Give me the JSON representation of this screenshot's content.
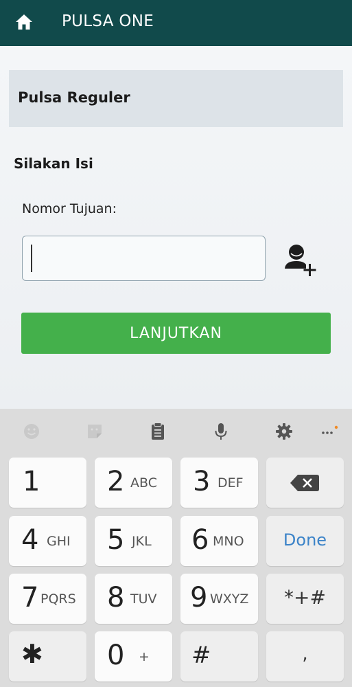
{
  "header": {
    "title": "PULSA ONE",
    "home_icon": "home-icon",
    "background": "#114a4b"
  },
  "main": {
    "section_title": "Pulsa Reguler",
    "fill_label": "Silakan Isi",
    "field_label": "Nomor Tujuan:",
    "phone_input": {
      "value": "",
      "placeholder": ""
    },
    "contact_icon": "add-contact-icon",
    "continue_label": "LANJUTKAN",
    "accent": "#44b04b"
  },
  "keyboard": {
    "toolbar_icons": [
      "emoji-icon",
      "sticker-icon",
      "clipboard-icon",
      "microphone-icon",
      "gear-icon",
      "more-icon"
    ],
    "keys": [
      {
        "main": "1",
        "sub": ""
      },
      {
        "main": "2",
        "sub": "ABC"
      },
      {
        "main": "3",
        "sub": "DEF"
      },
      {
        "icon": "backspace-icon"
      },
      {
        "main": "4",
        "sub": "GHI"
      },
      {
        "main": "5",
        "sub": "JKL"
      },
      {
        "main": "6",
        "sub": "MNO"
      },
      {
        "label": "Done"
      },
      {
        "main": "7",
        "sub": "PQRS"
      },
      {
        "main": "8",
        "sub": "TUV"
      },
      {
        "main": "9",
        "sub": "WXYZ"
      },
      {
        "label": "*+#"
      },
      {
        "main": "✱",
        "sub": ""
      },
      {
        "main": "0",
        "sub": "+"
      },
      {
        "main": "#",
        "sub": ""
      },
      {
        "label": ","
      }
    ]
  }
}
